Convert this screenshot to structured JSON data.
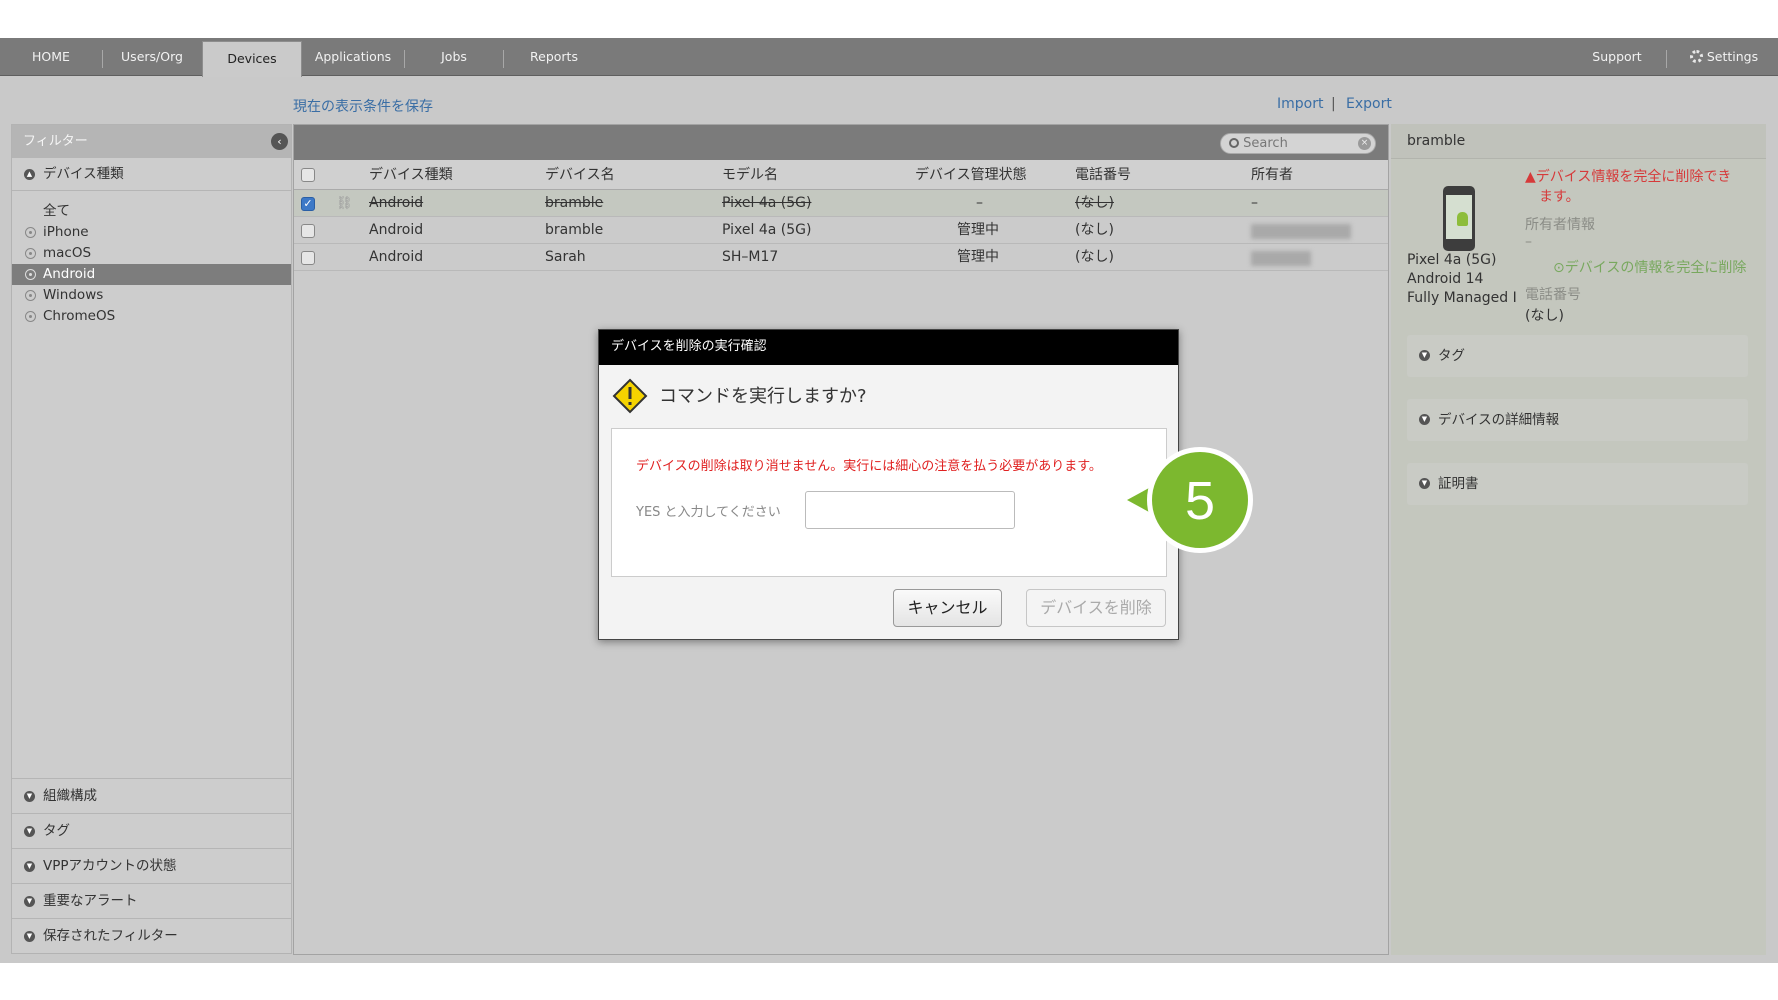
{
  "nav": {
    "tabs": [
      {
        "label": "HOME"
      },
      {
        "label": "Users/Org"
      },
      {
        "label": "Devices"
      },
      {
        "label": "Applications"
      },
      {
        "label": "Jobs"
      },
      {
        "label": "Reports"
      }
    ],
    "active_tab": "Devices",
    "support": "Support",
    "settings": "Settings"
  },
  "subbar": {
    "save_view": "現在の表示条件を保存",
    "import": "Import",
    "separator": "|",
    "export": "Export"
  },
  "filter": {
    "title": "フィルター",
    "device_type_section": "デバイス種類",
    "items": [
      "全て",
      "iPhone",
      "macOS",
      "Android",
      "Windows",
      "ChromeOS"
    ],
    "selected": "Android",
    "bottom_sections": [
      "組織構成",
      "タグ",
      "VPPアカウントの状態",
      "重要なアラート",
      "保存されたフィルター"
    ]
  },
  "table": {
    "search_placeholder": "Search",
    "columns": [
      "デバイス種類",
      "デバイス名",
      "モデル名",
      "デバイス管理状態",
      "電話番号",
      "所有者"
    ],
    "rows": [
      {
        "type": "Android",
        "name": "bramble",
        "model": "Pixel 4a (5G)",
        "status": "–",
        "phone": "(なし)",
        "owner": "–",
        "checked": true,
        "deleted": true
      },
      {
        "type": "Android",
        "name": "bramble",
        "model": "Pixel 4a (5G)",
        "status": "管理中",
        "phone": "(なし)",
        "owner": "",
        "checked": false,
        "deleted": false
      },
      {
        "type": "Android",
        "name": "Sarah",
        "model": "SH–M17",
        "status": "管理中",
        "phone": "(なし)",
        "owner": "",
        "checked": false,
        "deleted": false
      }
    ]
  },
  "detail": {
    "title": "bramble",
    "warning": "デバイス情報を完全に削除でき",
    "warning_line2": "ます。",
    "owner_label": "所有者情報",
    "owner_value": "–",
    "delete_link": "デバイスの情報を完全に削除",
    "phone_label": "電話番号",
    "phone_value": "(なし)",
    "model": "Pixel 4a (5G)",
    "os": "Android 14",
    "mode": "Fully Managed I",
    "sections": [
      "タグ",
      "デバイスの詳細情報",
      "証明書"
    ]
  },
  "modal": {
    "title": "デバイスを削除の実行確認",
    "question": "コマンドを実行しますか?",
    "message": "デバイスの削除は取り消せません。実行には細心の注意を払う必要があります。",
    "input_label": "YES と入力してください",
    "input_value": "",
    "cancel": "キャンセル",
    "confirm": "デバイスを削除"
  },
  "callout": {
    "number": "5",
    "color": "#7cb82f"
  },
  "colors": {
    "nav_bg": "#7a7a7a",
    "link": "#3a6ea5",
    "danger": "#e02020",
    "checkbox": "#3d79c7"
  }
}
